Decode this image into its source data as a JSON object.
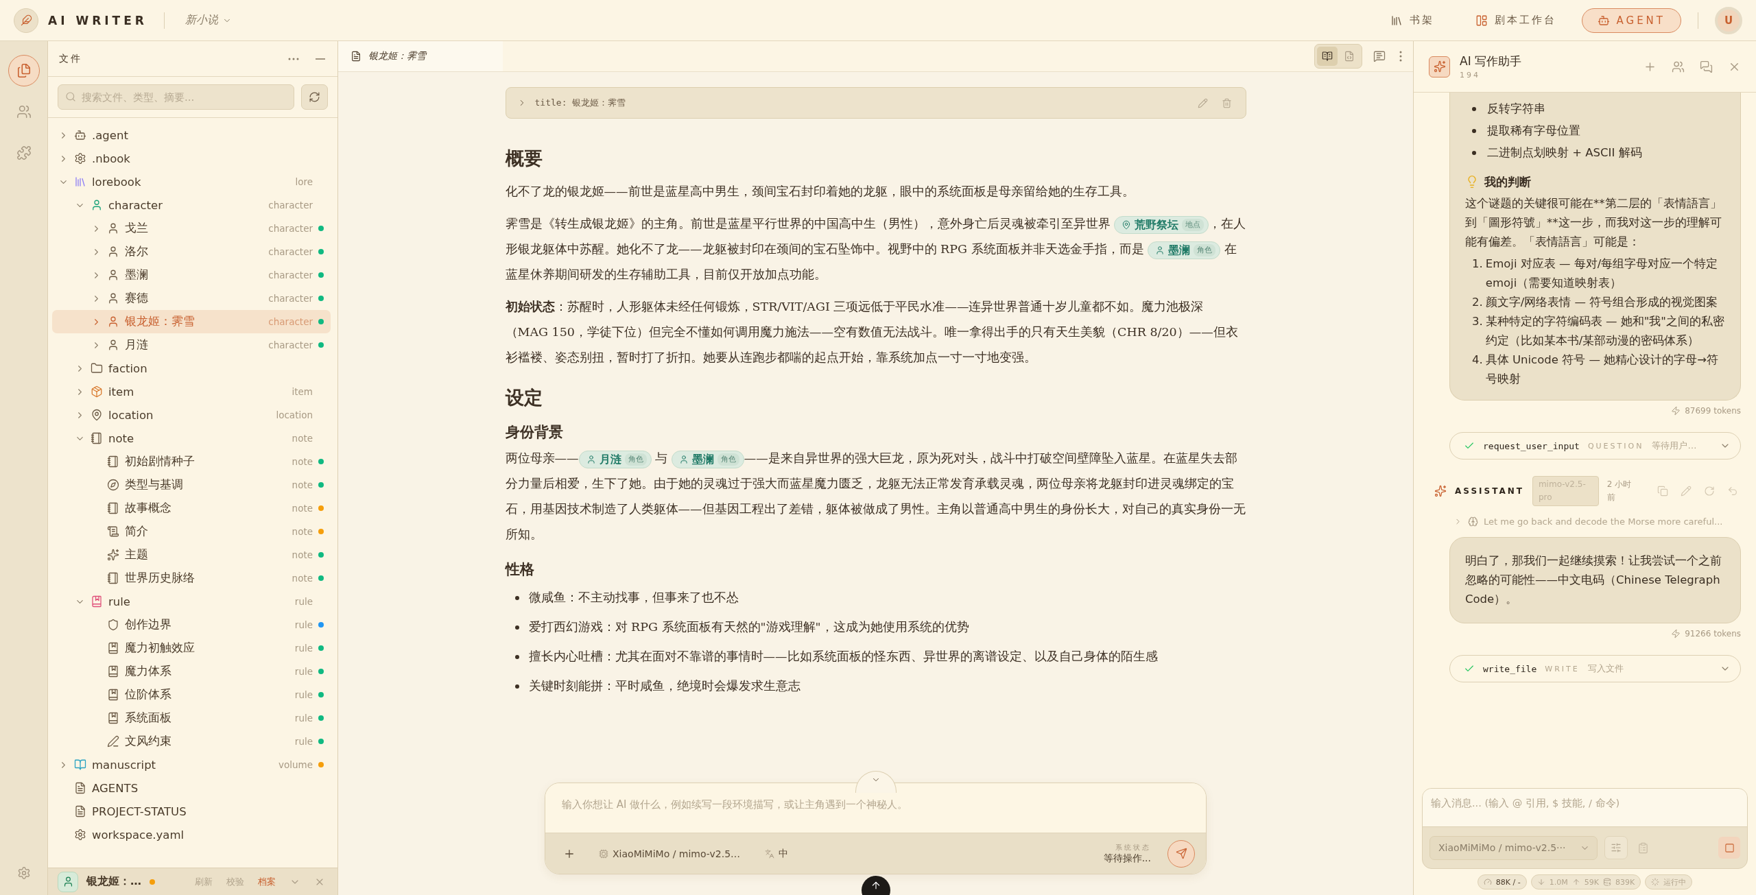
{
  "app": {
    "name": "AI WRITER",
    "project": "新小说"
  },
  "nav": [
    {
      "label": "书架",
      "selected": false
    },
    {
      "label": "剧本工作台",
      "selected": false
    },
    {
      "label": "AGENT",
      "selected": true
    }
  ],
  "user": {
    "initial": "U"
  },
  "rail": [
    {
      "selected": true
    },
    {
      "selected": false
    },
    {
      "selected": false
    }
  ],
  "sidebar": {
    "title": "文件",
    "search": {
      "placeholder": "搜索文件、类型、摘要..."
    },
    "tree": [
      {
        "kind": "bot",
        "label": ".agent",
        "expanded": false,
        "selected": false
      },
      {
        "kind": "gear",
        "label": ".nbook",
        "expanded": false,
        "selected": false
      },
      {
        "kind": "library",
        "label": "lorebook",
        "tag": "lore",
        "expanded": true,
        "selected": false,
        "children": [
          {
            "kind": "character",
            "label": "character",
            "tag": "character",
            "expanded": true,
            "selected": false,
            "children": [
              {
                "kind": "person",
                "label": "戈兰",
                "tag": "character",
                "color": "#10b981",
                "expanded": false,
                "selected": false
              },
              {
                "kind": "person",
                "label": "洛尔",
                "tag": "character",
                "color": "#10b981",
                "expanded": false,
                "selected": false
              },
              {
                "kind": "person",
                "label": "墨澜",
                "tag": "character",
                "color": "#10b981",
                "expanded": false,
                "selected": false
              },
              {
                "kind": "person",
                "label": "赛德",
                "tag": "character",
                "color": "#10b981",
                "expanded": false,
                "selected": false
              },
              {
                "kind": "person",
                "label": "银龙姬：霁雪",
                "tag": "character",
                "color": "#10b981",
                "expanded": false,
                "selected": true
              },
              {
                "kind": "person",
                "label": "月涟",
                "tag": "character",
                "color": "#10b981",
                "expanded": false,
                "selected": false
              }
            ]
          },
          {
            "kind": "folder",
            "label": "faction",
            "expanded": false,
            "selected": false
          },
          {
            "kind": "box",
            "label": "item",
            "tag": "item",
            "expanded": false,
            "selected": false
          },
          {
            "kind": "location",
            "label": "location",
            "tag": "location",
            "expanded": false,
            "selected": false
          },
          {
            "kind": "notebook",
            "label": "note",
            "tag": "note",
            "expanded": true,
            "selected": false,
            "children": [
              {
                "kind": "notebook",
                "label": "初始剧情种子",
                "tag": "note",
                "color": "#10b981",
                "selected": false
              },
              {
                "kind": "compass",
                "label": "类型与基调",
                "tag": "note",
                "color": "#10b981",
                "selected": false
              },
              {
                "kind": "notebook",
                "label": "故事概念",
                "tag": "note",
                "color": "#f59e0b",
                "selected": false
              },
              {
                "kind": "scroll",
                "label": "简介",
                "tag": "note",
                "color": "#f59e0b",
                "selected": false
              },
              {
                "kind": "sparkles",
                "label": "主题",
                "tag": "note",
                "color": "#10b981",
                "selected": false
              },
              {
                "kind": "notebook",
                "label": "世界历史脉络",
                "tag": "note",
                "color": "#10b981",
                "selected": false
              }
            ]
          },
          {
            "kind": "rulebook",
            "label": "rule",
            "tag": "rule",
            "expanded": true,
            "selected": false,
            "children": [
              {
                "kind": "shield",
                "label": "创作边界",
                "tag": "rule",
                "color": "#2196f3",
                "selected": false
              },
              {
                "kind": "rule",
                "label": "魔力初触效应",
                "tag": "rule",
                "color": "#10b981",
                "selected": false
              },
              {
                "kind": "rule",
                "label": "魔力体系",
                "tag": "rule",
                "color": "#10b981",
                "selected": false
              },
              {
                "kind": "rule",
                "label": "位阶体系",
                "tag": "rule",
                "color": "#10b981",
                "selected": false
              },
              {
                "kind": "rule",
                "label": "系统面板",
                "tag": "rule",
                "color": "#10b981",
                "selected": false
              },
              {
                "kind": "pencil",
                "label": "文风约束",
                "tag": "rule",
                "color": "#10b981",
                "selected": false
              }
            ]
          }
        ]
      },
      {
        "kind": "book",
        "label": "manuscript",
        "tag": "volume",
        "color": "#f59e0b",
        "expanded": false,
        "selected": false
      },
      {
        "kind": "file",
        "label": "AGENTS",
        "selected": false
      },
      {
        "kind": "file",
        "label": "PROJECT-STATUS",
        "selected": false
      },
      {
        "kind": "gear",
        "label": "workspace.yaml",
        "selected": false
      }
    ],
    "footer": {
      "title": "银龙姬：…",
      "color": "#f59e0b",
      "tabs": [
        {
          "label": "刷新",
          "selected": false
        },
        {
          "label": "校验",
          "selected": false
        },
        {
          "label": "档案",
          "selected": true
        }
      ]
    }
  },
  "editor": {
    "tab": "银龙姬：霁雪",
    "view_modes": [
      {
        "selected": true
      },
      {
        "selected": false
      }
    ],
    "frontmatter": {
      "text": "title: 银龙姬：霁雪",
      "expanded": false
    },
    "blocks": [
      {
        "kind": "h1",
        "text": "概要"
      },
      {
        "kind": "p",
        "segments": [
          {
            "kind": "text",
            "text": "化不了龙的银龙姬——前世是蓝星高中男生，颈间宝石封印着她的龙躯，眼中的系统面板是母亲留给她的生存工具。"
          }
        ]
      },
      {
        "kind": "p",
        "segments": [
          {
            "kind": "text",
            "text": "霁雪是《转生成银龙姬》的主角。前世是蓝星平行世界的中国高中生（男性），意外身亡后灵魂被牵引至异世界 "
          },
          {
            "kind": "place",
            "label": "荒野祭坛",
            "tag": "地点"
          },
          {
            "kind": "text",
            "text": "，在人形银龙躯体中苏醒。她化不了龙——龙躯被封印在颈间的宝石坠饰中。视野中的 RPG 系统面板并非天选金手指，而是 "
          },
          {
            "kind": "person",
            "label": "墨澜",
            "tag": "角色"
          },
          {
            "kind": "text",
            "text": " 在蓝星休养期间研发的生存辅助工具，目前仅开放加点功能。"
          }
        ]
      },
      {
        "kind": "p",
        "segments": [
          {
            "kind": "text",
            "text": "**初始状态**：苏醒时，人形躯体未经任何锻炼，STR/VIT/AGI 三项远低于平民水准——连异世界普通十岁儿童都不如。魔力池极深（MAG 150，学徒下位）但完全不懂如何调用魔力施法——空有数值无法战斗。唯一拿得出手的只有天生美貌（CHR 8/20）——但衣衫褴褛、姿态别扭，暂时打了折扣。她要从连跑步都喘的起点开始，靠系统加点一寸一寸地变强。"
          }
        ]
      },
      {
        "kind": "h1",
        "text": "设定"
      },
      {
        "kind": "h2",
        "text": "身份背景"
      },
      {
        "kind": "p",
        "segments": [
          {
            "kind": "text",
            "text": "两位母亲——"
          },
          {
            "kind": "person",
            "label": "月涟",
            "tag": "角色"
          },
          {
            "kind": "text",
            "text": " 与 "
          },
          {
            "kind": "person",
            "label": "墨澜",
            "tag": "角色"
          },
          {
            "kind": "text",
            "text": "——是来自异世界的强大巨龙，原为死对头，战斗中打破空间壁障坠入蓝星。在蓝星失去部分力量后相爱，生下了她。由于她的灵魂过于强大而蓝星魔力匮乏，龙躯无法正常发育承载灵魂，两位母亲将龙躯封印进灵魂绑定的宝石，用基因技术制造了人类躯体——但基因工程出了差错，躯体被做成了男性。主角以普通高中男生的身份长大，对自己的真实身份一无所知。"
          }
        ]
      },
      {
        "kind": "h2",
        "text": "性格"
      },
      {
        "kind": "list",
        "items": [
          "微咸鱼：不主动找事，但事来了也不怂",
          "爱打西幻游戏：对 RPG 系统面板有天然的\"游戏理解\"，这成为她使用系统的优势",
          "擅长内心吐槽：尤其在面对不靠谱的事情时——比如系统面板的怪东西、异世界的离谱设定、以及自己身体的陌生感",
          "关键时刻能拼：平时咸鱼，绝境时会爆发求生意志"
        ]
      }
    ],
    "composer": {
      "placeholder": "输入你想让 AI 做什么，例如续写一段环境描写，或让主角遇到一个神秘人。",
      "model": "XiaoMiMiMo / mimo-v2.5…",
      "language": "中",
      "status_label": "系统状态",
      "status": "等待操作..."
    }
  },
  "assistant": {
    "title": "AI 写作助手",
    "count": "194",
    "messages": [
      {
        "kind": "bubble",
        "blocks": [
          {
            "kind": "ul",
            "items": [
              "反转字符串",
              "提取稀有字母位置",
              "二进制点划映射 + ASCII 解码"
            ]
          },
          {
            "kind": "h3",
            "text": "我的判断"
          },
          {
            "kind": "p",
            "text": "这个谜题的关键很可能在**第二层的「表情語言」到「圖形符號」**这一步，而我对这一步的理解可能有偏差。「表情語言」可能是："
          },
          {
            "kind": "ol",
            "items": [
              {
                "marker": "1.",
                "text": "Emoji 对应表 — 每对/每组字母对应一个特定 emoji（需要知道映射表）"
              },
              {
                "marker": "2.",
                "text": "颜文字/网络表情 — 符号组合形成的视觉图案"
              },
              {
                "marker": "3.",
                "text": "某种特定的字符编码表 — 她和\"我\"之间的私密约定（比如某本书/某部动漫的密码体系）"
              },
              {
                "marker": "4.",
                "text": "具体 Unicode 符号 — 她精心设计的字母→符号映射"
              }
            ]
          }
        ],
        "tokens": "87699 tokens"
      },
      {
        "kind": "tool",
        "done": true,
        "name": "request_user_input",
        "type": "QUESTION",
        "status": "等待用户…"
      },
      {
        "kind": "header",
        "role": "ASSISTANT",
        "model": "mimo-v2.5-pro",
        "time": "2 小时前"
      },
      {
        "kind": "thinking",
        "expanded": false,
        "text": "Let me go back and decode the Morse more careful..."
      },
      {
        "kind": "bubble",
        "blocks": [
          {
            "kind": "p",
            "text": "明白了，那我们一起继续摸索！让我尝试一个之前忽略的可能性——中文电码（Chinese Telegraph Code）。"
          }
        ],
        "tokens": "91266 tokens"
      },
      {
        "kind": "tool",
        "done": true,
        "name": "write_file",
        "type": "WRITE",
        "status": "写入文件"
      }
    ],
    "composer": {
      "placeholder": "输入消息... (输入 @ 引用, $ 技能, / 命令)",
      "model": "XiaoMiMiMo / mimo-v2.5···"
    },
    "stats": {
      "context": "88K / -",
      "down": "1.0M",
      "up": "59K",
      "cache": "839K",
      "state": "运行中"
    }
  }
}
